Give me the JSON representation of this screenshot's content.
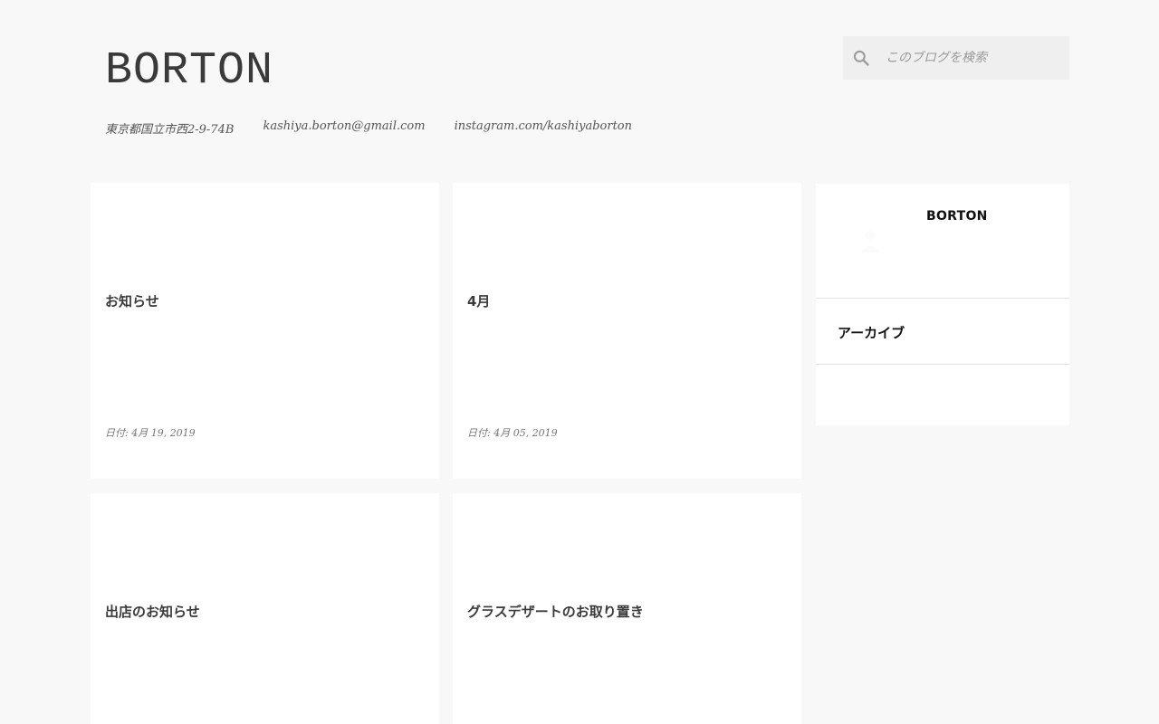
{
  "header": {
    "title": "BORTON",
    "address": "東京都国立市西2-9-74B",
    "email": "kashiya.borton@gmail.com",
    "instagram": "instagram.com/kashiyaborton"
  },
  "search": {
    "placeholder": "このブログを検索",
    "icon": "search-icon"
  },
  "posts": [
    {
      "title": "お知らせ",
      "date": "日付: 4月 19, 2019"
    },
    {
      "title": "4月",
      "date": "日付: 4月 05, 2019"
    },
    {
      "title": "出店のお知らせ"
    },
    {
      "title": "グラスデザートのお取り置き"
    }
  ],
  "sidebar": {
    "profile_name": "BORTON",
    "archive_title": "アーカイブ"
  },
  "colors": {
    "background": "#f8f8f8",
    "card": "#ffffff",
    "search_bg": "#efefef"
  }
}
